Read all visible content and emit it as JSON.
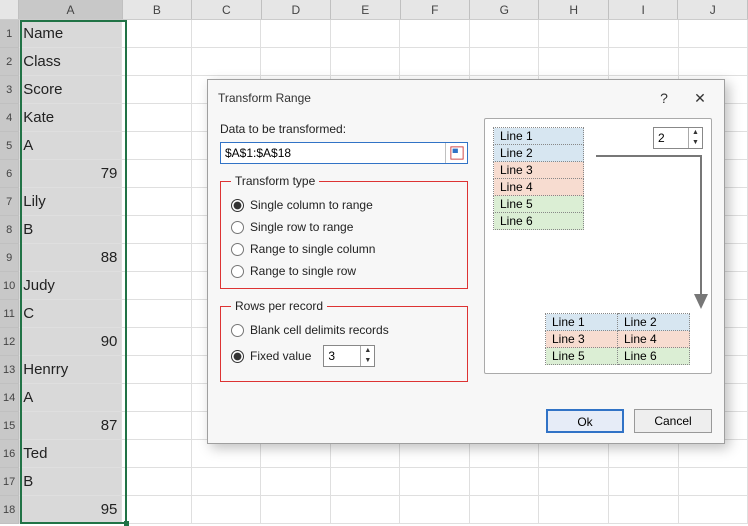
{
  "sheet": {
    "col_headers": [
      "A",
      "B",
      "C",
      "D",
      "E",
      "F",
      "G",
      "H",
      "I",
      "J"
    ],
    "rows": [
      {
        "n": 1,
        "a": "Name",
        "num": false
      },
      {
        "n": 2,
        "a": "Class",
        "num": false
      },
      {
        "n": 3,
        "a": "Score",
        "num": false
      },
      {
        "n": 4,
        "a": "Kate",
        "num": false
      },
      {
        "n": 5,
        "a": "A",
        "num": false
      },
      {
        "n": 6,
        "a": "79",
        "num": true
      },
      {
        "n": 7,
        "a": "Lily",
        "num": false
      },
      {
        "n": 8,
        "a": "B",
        "num": false
      },
      {
        "n": 9,
        "a": "88",
        "num": true
      },
      {
        "n": 10,
        "a": "Judy",
        "num": false
      },
      {
        "n": 11,
        "a": "C",
        "num": false
      },
      {
        "n": 12,
        "a": "90",
        "num": true
      },
      {
        "n": 13,
        "a": "Henrry",
        "num": false
      },
      {
        "n": 14,
        "a": "A",
        "num": false
      },
      {
        "n": 15,
        "a": "87",
        "num": true
      },
      {
        "n": 16,
        "a": "Ted",
        "num": false
      },
      {
        "n": 17,
        "a": "B",
        "num": false
      },
      {
        "n": 18,
        "a": "95",
        "num": true
      }
    ]
  },
  "dialog": {
    "title": "Transform Range",
    "help": "?",
    "close": "✕",
    "data_label": "Data to be transformed:",
    "range_value": "$A$1:$A$18",
    "transform_type": {
      "legend": "Transform type",
      "options": {
        "scr": "Single column to range",
        "srr": "Single row to range",
        "rsc": "Range to single column",
        "rsr": "Range to single row"
      },
      "selected": "scr"
    },
    "rows_per_record": {
      "legend": "Rows per record",
      "options": {
        "blank": "Blank cell delimits records",
        "fixed": "Fixed value"
      },
      "selected": "fixed",
      "fixed_value": "3"
    },
    "preview": {
      "cols_per_record": "2",
      "lines_in": [
        "Line 1",
        "Line 2",
        "Line 3",
        "Line 4",
        "Line 5",
        "Line 6"
      ],
      "lines_out": [
        [
          "Line 1",
          "Line 2"
        ],
        [
          "Line 3",
          "Line 4"
        ],
        [
          "Line 5",
          "Line 6"
        ]
      ]
    },
    "buttons": {
      "ok": "Ok",
      "cancel": "Cancel"
    }
  }
}
